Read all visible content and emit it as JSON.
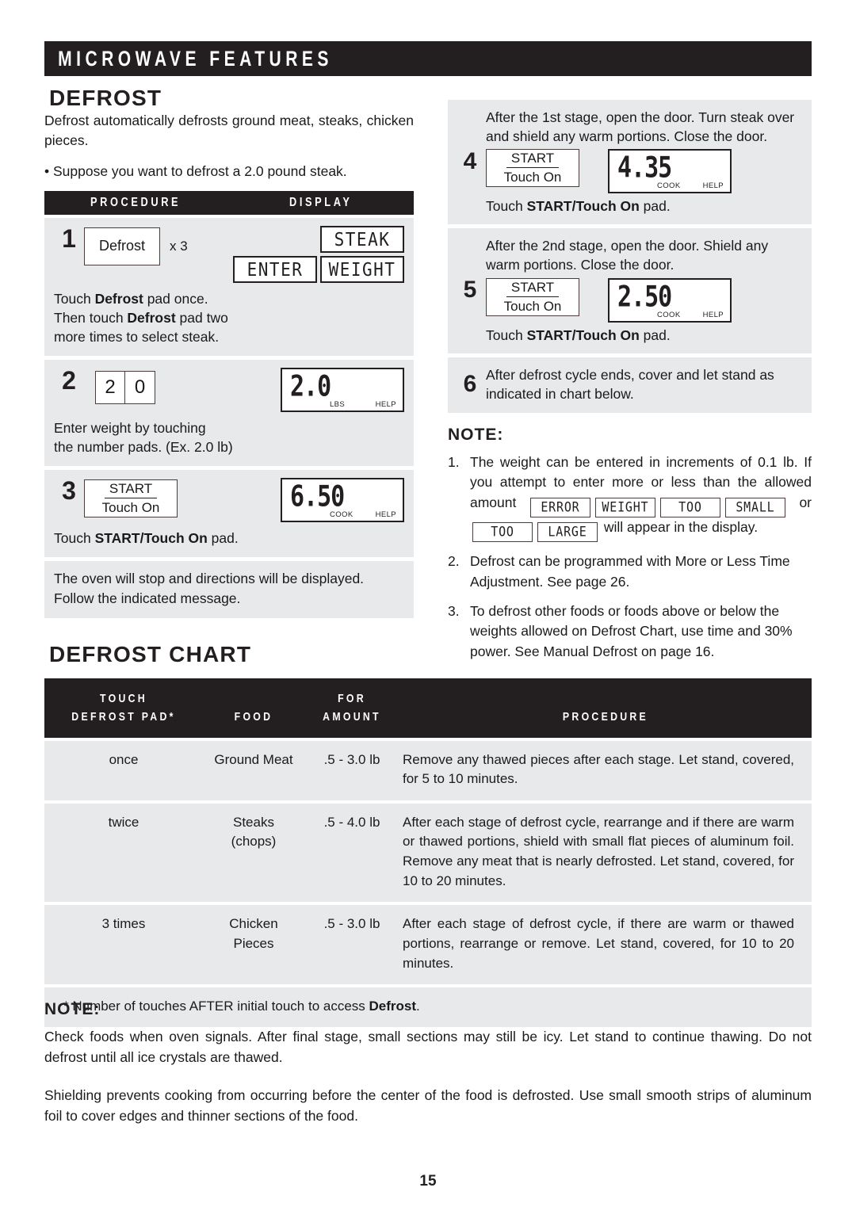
{
  "banner": {
    "title": "MICROWAVE FEATURES"
  },
  "defrost": {
    "heading": "DEFROST",
    "intro": "Defrost automatically defrosts ground meat, steaks, chicken pieces.",
    "bullet": "• Suppose you want to defrost a 2.0 pound steak.",
    "table_headers": {
      "procedure": "PROCEDURE",
      "display": "DISPLAY"
    },
    "steps": [
      {
        "number": "1",
        "pad_label": "Defrost",
        "multiplier": "x 3",
        "caption_parts": [
          "Touch ",
          "Defrost",
          " pad once."
        ],
        "caption_line2_parts": [
          "Then touch ",
          "Defrost",
          " pad two"
        ],
        "caption_line3": "more times to select steak.",
        "displays": [
          "STEAK",
          "ENTER",
          "WEIGHT"
        ]
      },
      {
        "number": "2",
        "pads": [
          "2",
          "0"
        ],
        "caption_line1": "Enter weight by touching",
        "caption_line2": "the number pads. (Ex. 2.0 lb)",
        "display_value": "2.0",
        "display_label_left": "LBS",
        "display_label_right": "HELP"
      },
      {
        "number": "3",
        "pad_top": "START",
        "pad_bottom": "Touch On",
        "caption_parts": [
          "Touch ",
          "START/Touch On",
          " pad."
        ],
        "display_value": "6.50",
        "display_label_left": "COOK",
        "display_label_right": "HELP"
      }
    ],
    "stop_note": "The oven will stop and directions will be displayed. Follow the indicated message."
  },
  "right_steps": [
    {
      "number": "4",
      "text": "After the 1st stage, open the door. Turn steak over and shield any warm portions. Close the door.",
      "pad_top": "START",
      "pad_bottom": "Touch On",
      "caption_parts": [
        "Touch ",
        "START/Touch On",
        " pad."
      ],
      "display_value": "4.35",
      "display_label_left": "COOK",
      "display_label_right": "HELP"
    },
    {
      "number": "5",
      "text": "After the 2nd stage, open the door. Shield any warm portions. Close the door.",
      "pad_top": "START",
      "pad_bottom": "Touch On",
      "caption_parts": [
        "Touch ",
        "START/Touch On",
        " pad."
      ],
      "display_value": "2.50",
      "display_label_left": "COOK",
      "display_label_right": "HELP"
    },
    {
      "number": "6",
      "text": "After defrost cycle ends, cover and let stand as indicated in chart below."
    }
  ],
  "note_top": {
    "heading": "NOTE:",
    "items": [
      {
        "marker": "1.",
        "text_before": "The weight can be entered in increments of 0.1 lb. If you attempt to enter more or less than the allowed amount",
        "chips_line1": [
          "ERROR",
          "WEIGHT",
          "TOO",
          "SMALL"
        ],
        "text_mid": "or",
        "chips_line2": [
          "TOO",
          "LARGE"
        ],
        "text_after": "will appear in the display."
      },
      {
        "marker": "2.",
        "text": "Defrost can be programmed with More or Less Time Adjustment. See page 26."
      },
      {
        "marker": "3.",
        "text": "To defrost other foods or foods above or below the weights allowed on Defrost Chart, use time and 30% power. See Manual Defrost on page 16."
      }
    ]
  },
  "chart": {
    "heading": "DEFROST CHART",
    "headers": {
      "touch": [
        "TOUCH",
        "DEFROST PAD*"
      ],
      "food": "FOOD",
      "amount": [
        "FOR",
        "AMOUNT"
      ],
      "procedure": "PROCEDURE"
    },
    "rows": [
      {
        "touch": "once",
        "food": "Ground Meat",
        "amount": ".5 - 3.0 lb",
        "procedure": "Remove any thawed pieces after each stage. Let stand, covered, for 5 to 10 minutes."
      },
      {
        "touch": "twice",
        "food": "Steaks\n(chops)",
        "amount": ".5 - 4.0 lb",
        "procedure": "After each stage of defrost cycle, rearrange and if there are warm or thawed portions, shield with small flat pieces of aluminum foil. Remove any meat that is nearly defrosted. Let stand, covered, for 10 to 20 minutes."
      },
      {
        "touch": "3 times",
        "food": "Chicken\nPieces",
        "amount": ".5 - 3.0 lb",
        "procedure": "After each stage of defrost cycle, if there are warm or thawed portions, rearrange or remove. Let stand, covered, for 10 to 20 minutes."
      }
    ],
    "footnote_parts": [
      "* Number of touches AFTER initial touch to access ",
      "Defrost",
      "."
    ]
  },
  "note_bottom": {
    "heading": "NOTE:",
    "paragraph1": "Check foods when oven signals. After final stage, small sections may still be icy. Let stand to continue thawing. Do not defrost until all ice crystals are thawed.",
    "paragraph2": "Shielding prevents cooking from occurring before the center of the food is defrosted. Use small smooth strips of aluminum foil to cover edges and thinner sections of the food."
  },
  "page_number": "15",
  "colors": {
    "ink": "#231f20",
    "panel": "#e8e9ea",
    "pad_border": "#4a3c3c"
  }
}
